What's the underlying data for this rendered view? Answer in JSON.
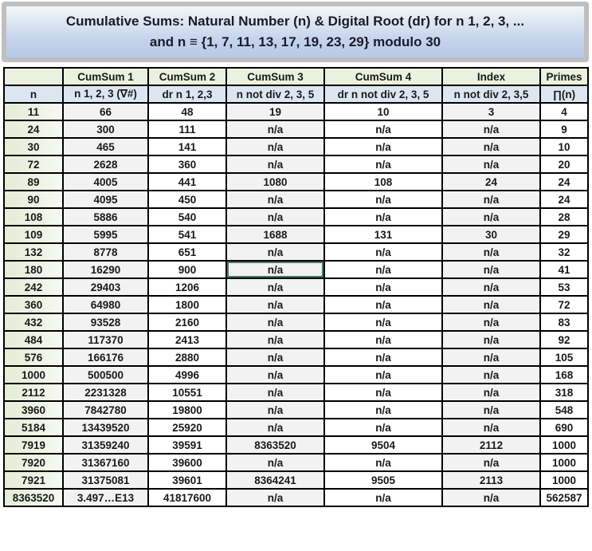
{
  "title": {
    "line1": "Cumulative Sums: Natural Number (n) & Digital Root (dr) for n 1, 2, 3, ...",
    "line2": "and n ≡ {1, 7, 11, 13, 17, 19, 23, 29} modulo 30"
  },
  "table": {
    "header_row1": [
      "",
      "CumSum 1",
      "CumSum 2",
      "CumSum 3",
      "CumSum 4",
      "Index",
      "Primes"
    ],
    "header_row2": [
      "n",
      "n 1, 2, 3 (∇#)",
      "dr n 1, 2,3",
      "n not div 2, 3, 5",
      "dr n not div 2, 3, 5",
      "n not div 2, 3,5",
      "∏(n)"
    ],
    "rows": [
      [
        "11",
        "66",
        "48",
        "19",
        "10",
        "3",
        "4"
      ],
      [
        "24",
        "300",
        "111",
        "n/a",
        "n/a",
        "n/a",
        "9"
      ],
      [
        "30",
        "465",
        "141",
        "n/a",
        "n/a",
        "n/a",
        "10"
      ],
      [
        "72",
        "2628",
        "360",
        "n/a",
        "n/a",
        "n/a",
        "20"
      ],
      [
        "89",
        "4005",
        "441",
        "1080",
        "108",
        "24",
        "24"
      ],
      [
        "90",
        "4095",
        "450",
        "n/a",
        "n/a",
        "n/a",
        "24"
      ],
      [
        "108",
        "5886",
        "540",
        "n/a",
        "n/a",
        "n/a",
        "28"
      ],
      [
        "109",
        "5995",
        "541",
        "1688",
        "131",
        "30",
        "29"
      ],
      [
        "132",
        "8778",
        "651",
        "n/a",
        "n/a",
        "n/a",
        "32"
      ],
      [
        "180",
        "16290",
        "900",
        "n/a",
        "n/a",
        "n/a",
        "41"
      ],
      [
        "242",
        "29403",
        "1206",
        "n/a",
        "n/a",
        "n/a",
        "53"
      ],
      [
        "360",
        "64980",
        "1800",
        "n/a",
        "n/a",
        "n/a",
        "72"
      ],
      [
        "432",
        "93528",
        "2160",
        "n/a",
        "n/a",
        "n/a",
        "83"
      ],
      [
        "484",
        "117370",
        "2413",
        "n/a",
        "n/a",
        "n/a",
        "92"
      ],
      [
        "576",
        "166176",
        "2880",
        "n/a",
        "n/a",
        "n/a",
        "105"
      ],
      [
        "1000",
        "500500",
        "4996",
        "n/a",
        "n/a",
        "n/a",
        "168"
      ],
      [
        "2112",
        "2231328",
        "10551",
        "n/a",
        "n/a",
        "n/a",
        "318"
      ],
      [
        "3960",
        "7842780",
        "19800",
        "n/a",
        "n/a",
        "n/a",
        "548"
      ],
      [
        "5184",
        "13439520",
        "25920",
        "n/a",
        "n/a",
        "n/a",
        "690"
      ],
      [
        "7919",
        "31359240",
        "39591",
        "8363520",
        "9504",
        "2112",
        "1000"
      ],
      [
        "7920",
        "31367160",
        "39600",
        "n/a",
        "n/a",
        "n/a",
        "1000"
      ],
      [
        "7921",
        "31375081",
        "39601",
        "8364241",
        "9505",
        "2113",
        "1000"
      ],
      [
        "8363520",
        "3.497…E13",
        "41817600",
        "n/a",
        "n/a",
        "n/a",
        "562587"
      ]
    ],
    "selected_cell": {
      "row": 9,
      "col": 3
    }
  }
}
